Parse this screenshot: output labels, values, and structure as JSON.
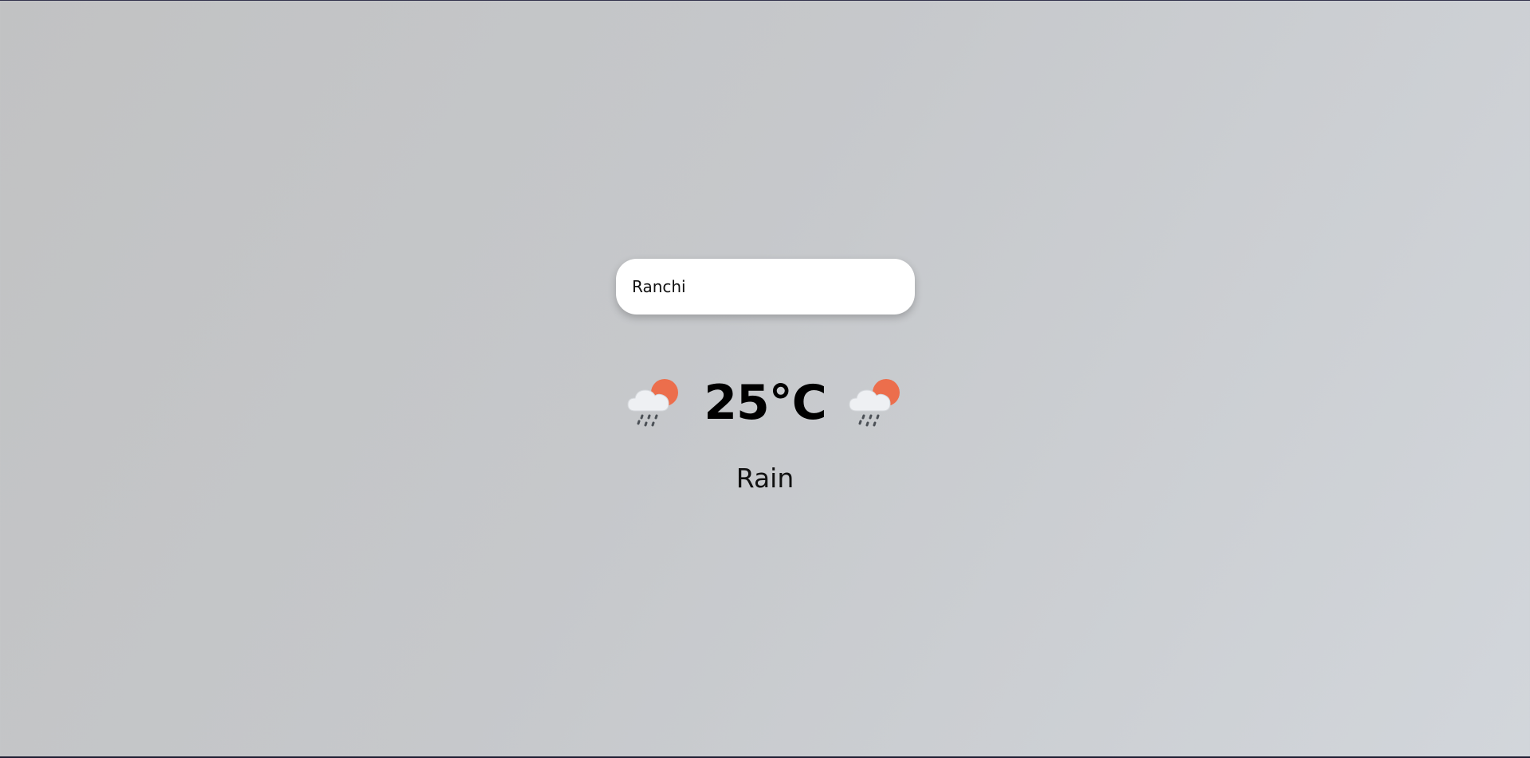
{
  "search": {
    "value": "Ranchi"
  },
  "weather": {
    "temperature": "25°C",
    "condition": "Rain",
    "icon": "sun-behind-rain-cloud-icon"
  },
  "colors": {
    "card_background": "#ffffff",
    "sun": "#ec6e4c",
    "cloud": "#eef0f3",
    "rain": "#4c5157",
    "text": "#000000"
  }
}
